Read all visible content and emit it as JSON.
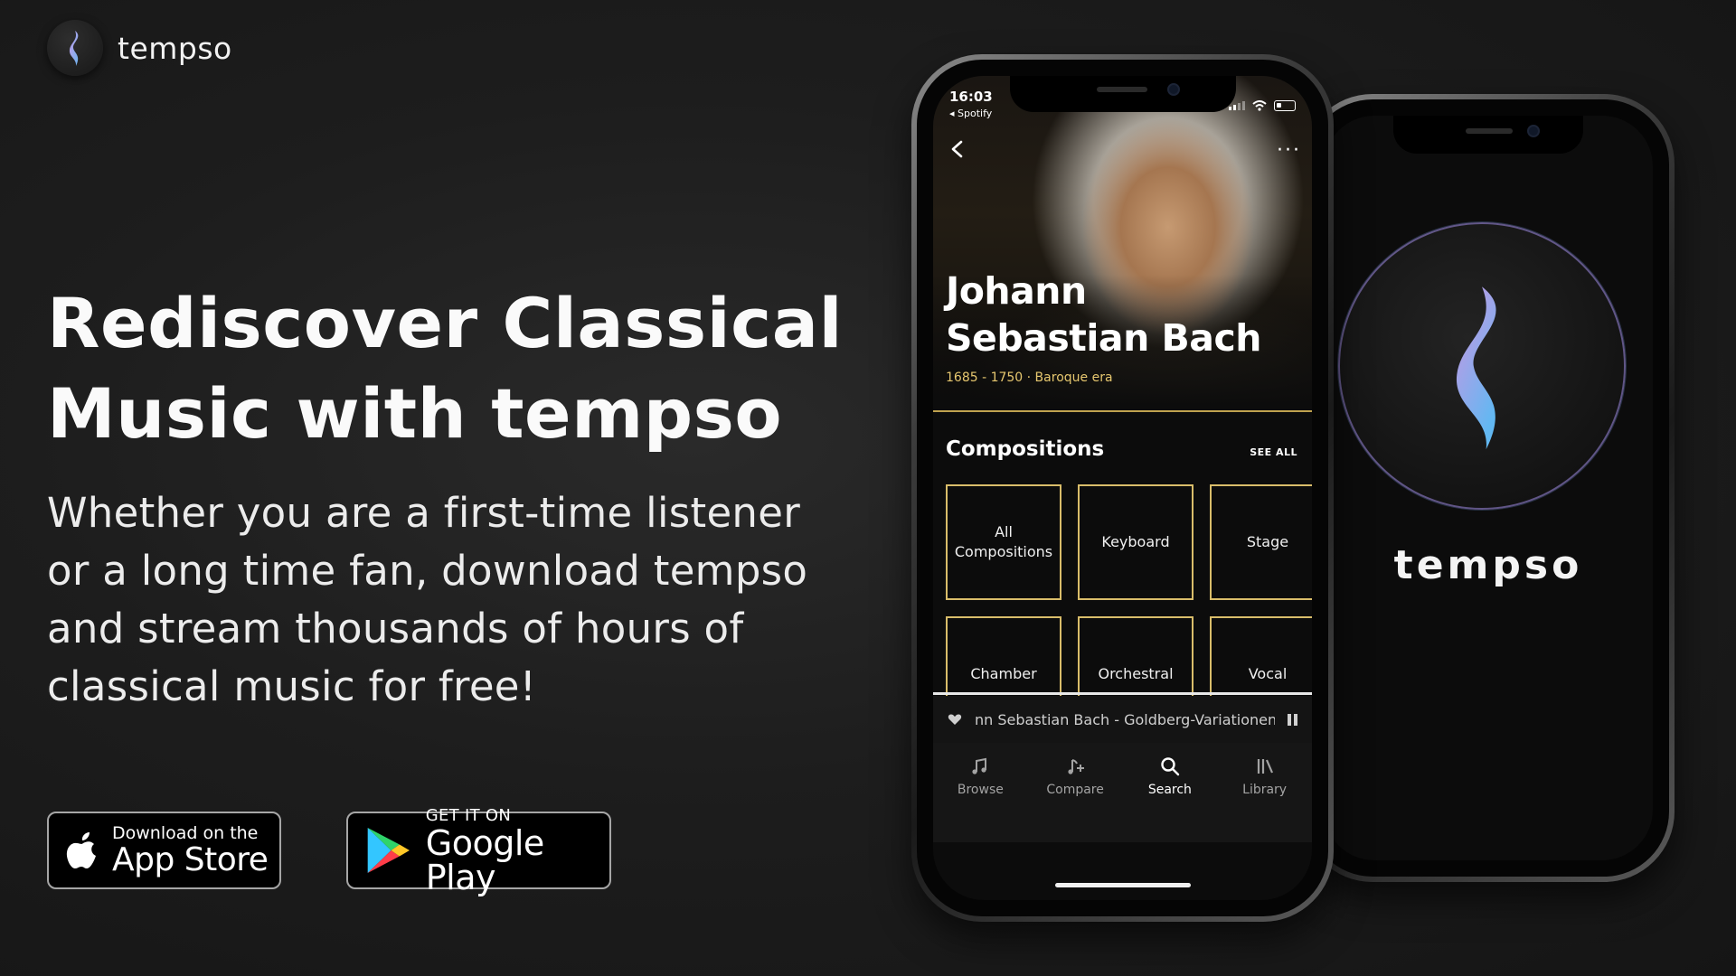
{
  "brand": {
    "name": "tempso"
  },
  "hero": {
    "headline_line1": "Rediscover Classical",
    "headline_line2": "Music with tempso",
    "body": "Whether you are a first-time listener or a long time fan, download tempso and stream thousands of hours of classical music for free!"
  },
  "badges": {
    "apple": {
      "small": "Download on the",
      "big": "App Store"
    },
    "google": {
      "small": "GET IT ON",
      "big": "Google Play"
    }
  },
  "splash": {
    "name": "tempso"
  },
  "app": {
    "status": {
      "time": "16:03",
      "back_app": "◂ Spotify"
    },
    "composer": {
      "name": "Johann Sebastian Bach",
      "meta": "1685 - 1750 · Baroque era"
    },
    "compositions": {
      "title": "Compositions",
      "see_all": "SEE ALL",
      "tiles": [
        "All Compositions",
        "Keyboard",
        "Stage",
        "Chamber",
        "Orchestral",
        "Vocal"
      ]
    },
    "player": {
      "track": "nn Sebastian Bach - Goldberg-Variationen"
    },
    "tabs": [
      {
        "label": "Browse",
        "icon": "music-note-icon"
      },
      {
        "label": "Compare",
        "icon": "music-note-plus-icon"
      },
      {
        "label": "Search",
        "icon": "search-icon",
        "active": true
      },
      {
        "label": "Library",
        "icon": "library-icon"
      }
    ]
  },
  "colors": {
    "gold": "#d9bd6a",
    "background": "#1d1d1d"
  }
}
